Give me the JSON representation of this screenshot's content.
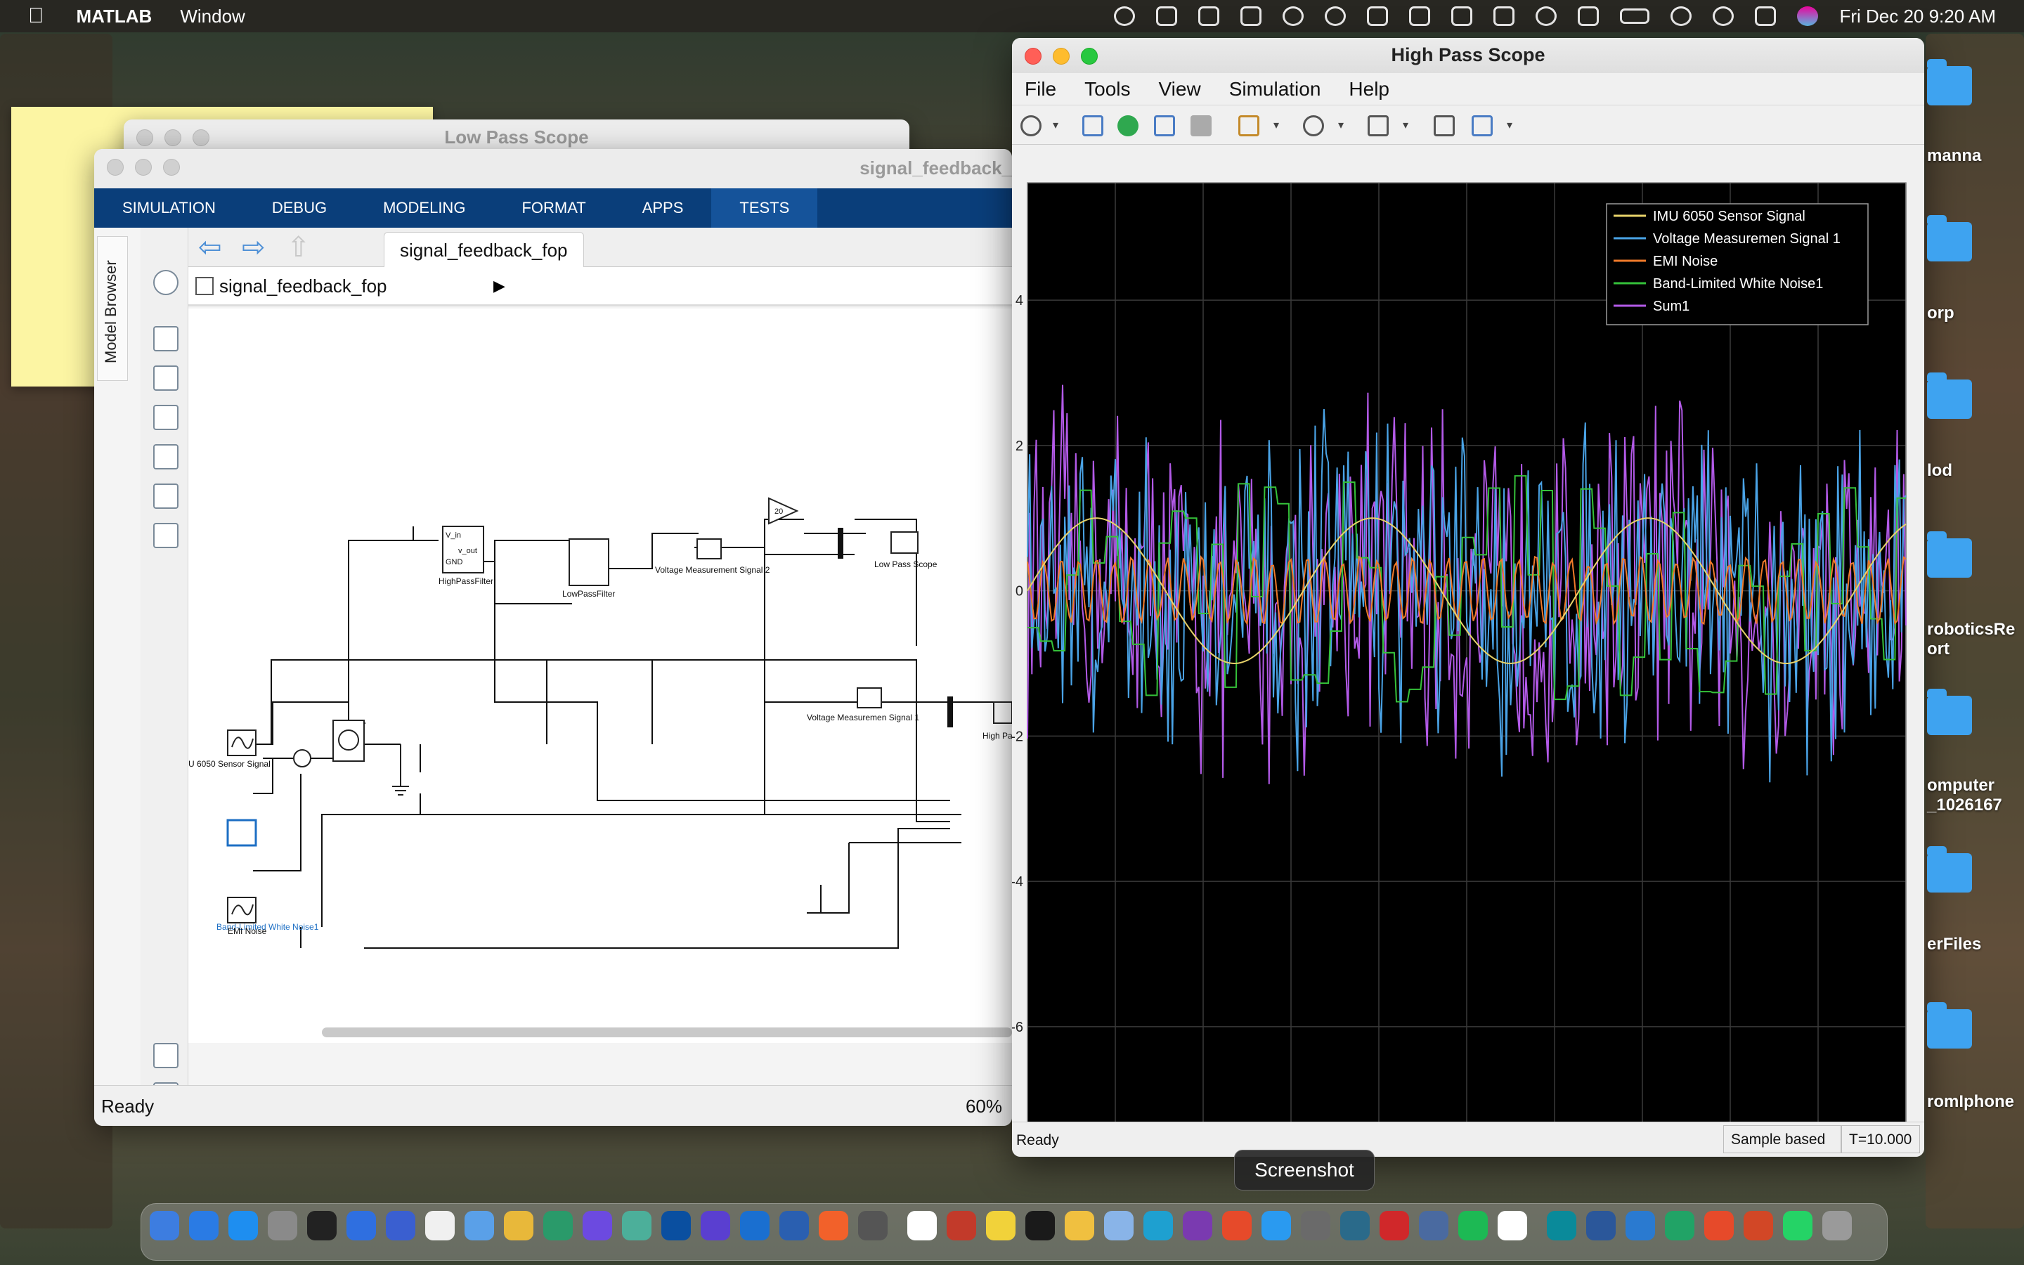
{
  "menubar": {
    "app_name": "MATLAB",
    "menu_window": "Window",
    "datetime": "Fri Dec 20  9:20 AM"
  },
  "low_pass_window": {
    "title": "Low Pass Scope"
  },
  "simulink": {
    "title": "signal_feedback_",
    "ribbon_tabs": [
      "SIMULATION",
      "DEBUG",
      "MODELING",
      "FORMAT",
      "APPS",
      "TESTS"
    ],
    "model_browser_label": "Model Browser",
    "tab_label": "signal_feedback_fop",
    "address": "signal_feedback_fop",
    "status_left": "Ready",
    "zoom": "60%",
    "blocks": {
      "imu": "U 6050 Sensor Signal",
      "band_limited": "Band-Limited White Noise1",
      "emi": "EMI Noise",
      "highpass": "HighPassFilter",
      "lowpass": "LowPassFilter",
      "vin": "V_in",
      "vout": "v_out",
      "gnd": "GND",
      "vms2": "Voltage Measurement Signal 2",
      "vms1": "Voltage Measuremen Signal 1",
      "gain": "20",
      "lowpass_scope": "Low Pass Scope",
      "highpass_scope": "High Pa"
    }
  },
  "scope": {
    "title": "High Pass Scope",
    "menus": [
      "File",
      "Tools",
      "View",
      "Simulation",
      "Help"
    ],
    "status_left": "Ready",
    "sample_mode": "Sample based",
    "time": "T=10.000"
  },
  "chart_data": {
    "type": "line",
    "title": "",
    "xlabel": "",
    "ylabel": "",
    "xlim": [
      0,
      10
    ],
    "ylim": [
      -7.5,
      5.5
    ],
    "xticks": [
      "0",
      "1",
      "2",
      "3",
      "4",
      "5",
      "6",
      "7",
      "8",
      "9",
      "10"
    ],
    "yticks": [
      "-6",
      "-4",
      "-2",
      "0",
      "2",
      "4"
    ],
    "grid": true,
    "legend_position": "top-right",
    "series": [
      {
        "name": "IMU 6050 Sensor Signal",
        "color": "#e8d36a",
        "kind": "sine",
        "amplitude": 1,
        "period": 3.14
      },
      {
        "name": "Voltage Measuremen Signal 1",
        "color": "#4aa3e6",
        "kind": "noise",
        "amplitude": 2.6
      },
      {
        "name": "EMI Noise",
        "color": "#f07a2a",
        "kind": "oscillation",
        "amplitude": 0.5,
        "period": 0.2
      },
      {
        "name": "Band-Limited White Noise1",
        "color": "#35c23a",
        "kind": "step-noise",
        "amplitude": 1.6
      },
      {
        "name": "Sum1",
        "color": "#b35ae8",
        "kind": "noise",
        "amplitude": 2.8
      }
    ]
  },
  "tooltip": "Screenshot",
  "desktop_items": [
    "manna",
    "orp",
    "lod",
    "roboticsRe ort",
    "omputer _1026167",
    "erFiles",
    "romIphone"
  ]
}
